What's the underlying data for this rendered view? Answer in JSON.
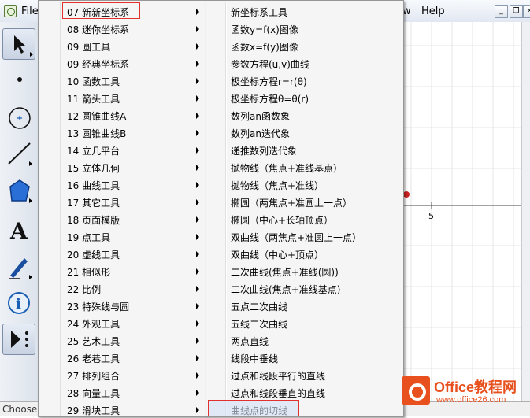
{
  "menubar": {
    "file": "File",
    "w_partial": "w",
    "help": "Help"
  },
  "window_buttons": {
    "minimize": "_",
    "restore": "❐",
    "close": "×"
  },
  "toolbar": [
    {
      "name": "arrow-tool-icon"
    },
    {
      "name": "point-tool-icon"
    },
    {
      "name": "compass-tool-icon"
    },
    {
      "name": "line-tool-icon"
    },
    {
      "name": "polygon-tool-icon"
    },
    {
      "name": "text-tool-icon"
    },
    {
      "name": "marker-tool-icon"
    },
    {
      "name": "info-tool-icon"
    },
    {
      "name": "custom-tool-icon"
    }
  ],
  "status": {
    "text": "Choose"
  },
  "canvas": {
    "tick_label": "5",
    "accent": "#cc2222"
  },
  "menu1": {
    "items": [
      {
        "label": "07 新新坐标系",
        "submenu": true
      },
      {
        "label": "08 迷你坐标系",
        "submenu": true
      },
      {
        "label": "09 圆工具",
        "submenu": true
      },
      {
        "label": "09 经典坐标系",
        "submenu": true
      },
      {
        "label": "10 函数工具",
        "submenu": true
      },
      {
        "label": "11 箭头工具",
        "submenu": true
      },
      {
        "label": "12 圆锥曲线A",
        "submenu": true
      },
      {
        "label": "13 圆锥曲线B",
        "submenu": true
      },
      {
        "label": "14 立几平台",
        "submenu": true
      },
      {
        "label": "15 立体几何",
        "submenu": true
      },
      {
        "label": "16 曲线工具",
        "submenu": true
      },
      {
        "label": "17 其它工具",
        "submenu": true
      },
      {
        "label": "18 页面模版",
        "submenu": true
      },
      {
        "label": "19 点工具",
        "submenu": true
      },
      {
        "label": "20 虚线工具",
        "submenu": true
      },
      {
        "label": "21 相似形",
        "submenu": true
      },
      {
        "label": "22 比例",
        "submenu": true
      },
      {
        "label": "23 特殊线与圆",
        "submenu": true
      },
      {
        "label": "24 外观工具",
        "submenu": true
      },
      {
        "label": "25 艺术工具",
        "submenu": true
      },
      {
        "label": "26 老巷工具",
        "submenu": true
      },
      {
        "label": "27 排列组合",
        "submenu": true
      },
      {
        "label": "28 向量工具",
        "submenu": true
      },
      {
        "label": "29 滑块工具",
        "submenu": true
      }
    ]
  },
  "menu2": {
    "items": [
      {
        "label": "新坐标系工具"
      },
      {
        "label": "函数y=f(x)图像"
      },
      {
        "label": "函数x=f(y)图像"
      },
      {
        "label": "参数方程(u,v)曲线"
      },
      {
        "label": "极坐标方程r=r(θ)"
      },
      {
        "label": "极坐标方程θ=θ(r)"
      },
      {
        "label": "数列an函数象"
      },
      {
        "label": "数列an迭代象"
      },
      {
        "label": "递推数列迭代象"
      },
      {
        "label": "抛物线（焦点+准线基点）"
      },
      {
        "label": "抛物线（焦点+准线）"
      },
      {
        "label": "椭圆（两焦点+准圆上一点）"
      },
      {
        "label": "椭圆（中心+长轴顶点）"
      },
      {
        "label": "双曲线（两焦点+准圆上一点）"
      },
      {
        "label": "双曲线（中心+顶点）"
      },
      {
        "label": "二次曲线(焦点+准线(圆))"
      },
      {
        "label": "二次曲线(焦点+准线基点)"
      },
      {
        "label": "五点二次曲线"
      },
      {
        "label": "五线二次曲线"
      },
      {
        "label": "两点直线"
      },
      {
        "label": "线段中垂线"
      },
      {
        "label": "过点和线段平行的直线"
      },
      {
        "label": "过点和线段垂直的直线"
      },
      {
        "label": "曲线点的切线"
      }
    ]
  },
  "watermark": {
    "title": "Office教程网",
    "url": "www.office26.com",
    "color": "#e8511e"
  }
}
